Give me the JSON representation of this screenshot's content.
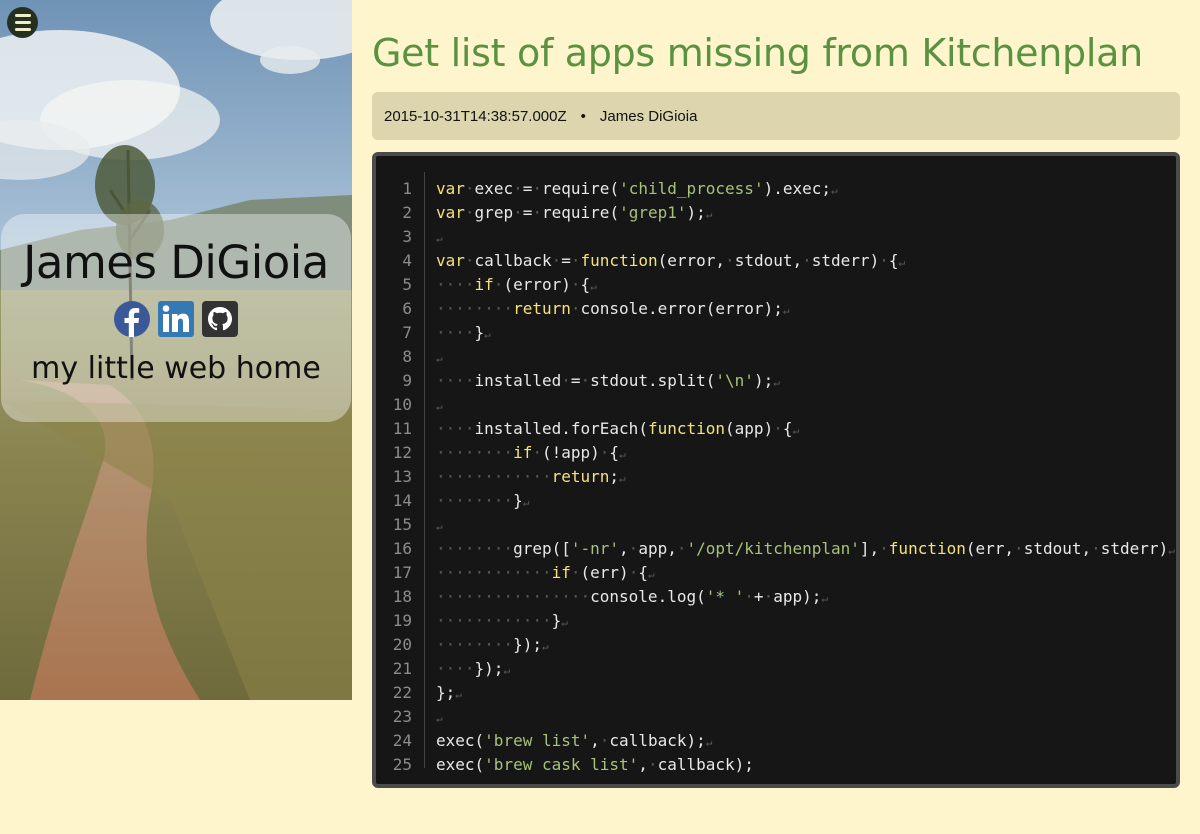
{
  "sidebar": {
    "menu_icon": "hamburger-menu-icon",
    "name": "James DiGioia",
    "tagline": "my little web home",
    "social": [
      {
        "icon": "facebook-icon",
        "color": "#3b5998"
      },
      {
        "icon": "linkedin-icon",
        "color": "#3478b4"
      },
      {
        "icon": "github-icon",
        "color": "#333333"
      }
    ]
  },
  "post": {
    "title": "Get list of apps missing from Kitchenplan",
    "date": "2015-10-31T14:38:57.000Z",
    "separator": "•",
    "author": "James DiGioia"
  },
  "code": {
    "lines": [
      "var exec = require('child_process').exec;",
      "var grep = require('grep1');",
      "",
      "var callback = function(error, stdout, stderr) {",
      "    if (error) {",
      "        return console.error(error);",
      "    }",
      "",
      "    installed = stdout.split('\\n');",
      "",
      "    installed.forEach(function(app) {",
      "        if (!app) {",
      "            return;",
      "        }",
      "",
      "        grep(['-nr', app, '/opt/kitchenplan'], function(err, stdout, stderr)",
      "            if (err) {",
      "                console.log('* ' + app);",
      "            }",
      "        });",
      "    });",
      "};",
      "",
      "exec('brew list', callback);",
      "exec('brew cask list', callback);"
    ],
    "colors": {
      "keyword": "#f5e27a",
      "string": "#a7c27a",
      "text": "#e8e8e8",
      "whitespace": "#5a5a5a",
      "line_number": "#8c8c8c"
    }
  }
}
